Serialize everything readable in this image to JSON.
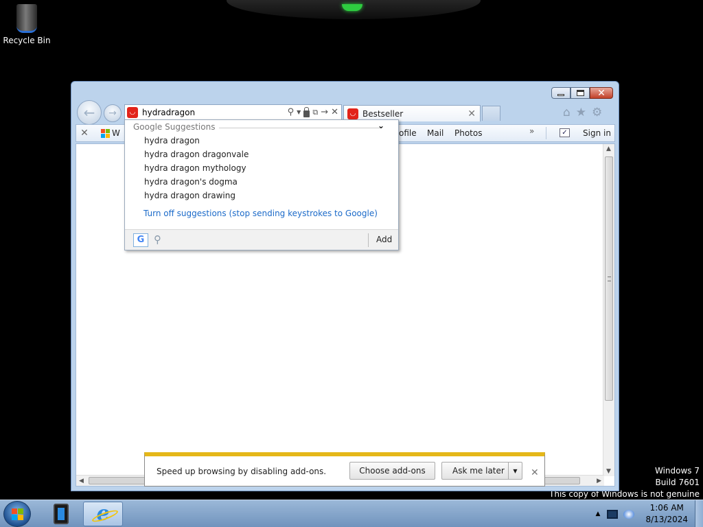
{
  "desktop": {
    "recycle_bin_label": "Recycle Bin",
    "watermark": {
      "line1": "Windows 7",
      "line2": "Build 7601",
      "line3": "This copy of Windows is not genuine"
    }
  },
  "browser": {
    "address_value": "hydradragon",
    "tab": {
      "label": "Bestseller",
      "favicon": "red-shopping-icon"
    },
    "command_bar": {
      "first_link_partial": "W",
      "links_partial": [
        "ofile",
        "Mail",
        "Photos"
      ],
      "signin": "Sign in",
      "more": "»"
    }
  },
  "dropdown": {
    "header": "Google Suggestions",
    "suggestions": [
      "hydra dragon",
      "hydra dragon dragonvale",
      "hydra dragon mythology",
      "hydra dragon's dogma",
      "hydra dragon drawing"
    ],
    "turn_off": "Turn off suggestions (stop sending keystrokes to Google)",
    "provider_letter": "G",
    "add": "Add"
  },
  "notification": {
    "text": "Speed up browsing by disabling add-ons.",
    "choose": "Choose add-ons",
    "ask": "Ask me later"
  },
  "taskbar": {
    "time": "1:06 AM",
    "date": "8/13/2024"
  },
  "colors": {
    "accent_link": "#1b6ac9",
    "notification_stripe": "#e5b719",
    "favicon_red": "#e2231a"
  }
}
